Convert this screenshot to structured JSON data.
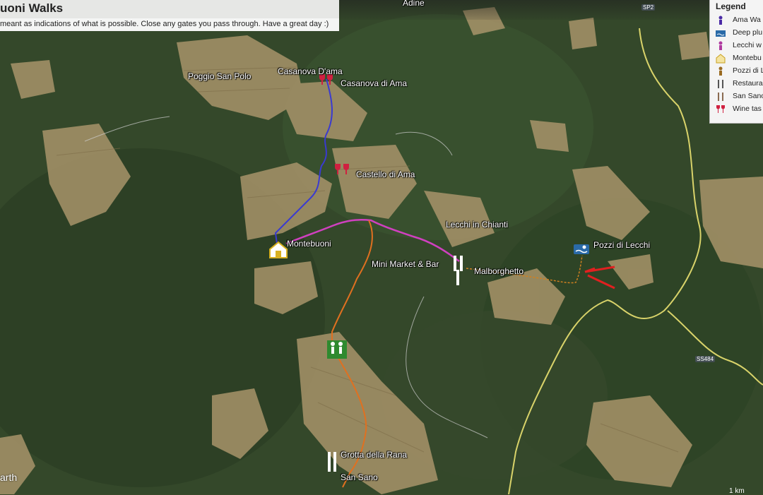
{
  "title": "uoni Walks",
  "subtitle": "meant as indications of what is possible. Close any gates you pass through. Have a great day :)",
  "top_place": "Adine",
  "legend": {
    "title": "Legend",
    "items": [
      {
        "label": "Ama Wa",
        "icon": "walker-purple-icon",
        "color": "#4a2aa6"
      },
      {
        "label": "Deep plu",
        "icon": "swimmer-icon",
        "color": "#2a6aa8"
      },
      {
        "label": "Lecchi w",
        "icon": "walker-pink-icon",
        "color": "#b03aa0"
      },
      {
        "label": "Montebu",
        "icon": "home-icon",
        "color": "#c8a020"
      },
      {
        "label": "Pozzi di L",
        "icon": "walker-brown-icon",
        "color": "#9a6a20"
      },
      {
        "label": "Restaura",
        "icon": "fork-knife-icon",
        "color": "#555555"
      },
      {
        "label": "San Sano",
        "icon": "fork-knife-icon",
        "color": "#8a6a50"
      },
      {
        "label": "Wine tas",
        "icon": "wine-glass-icon",
        "color": "#d02040"
      }
    ]
  },
  "places": [
    {
      "id": "poggio",
      "label": "Poggio San Polo"
    },
    {
      "id": "casanova-dama",
      "label": "Casanova D'ama"
    },
    {
      "id": "casanova-di-ama",
      "label": "Casanova di Ama"
    },
    {
      "id": "castello",
      "label": "Castello di Ama"
    },
    {
      "id": "montebuoni",
      "label": "Montebuoni"
    },
    {
      "id": "lecchi",
      "label": "Lecchi in Chianti"
    },
    {
      "id": "minimarket",
      "label": "Mini Market & Bar"
    },
    {
      "id": "malborghetto",
      "label": "Malborghetto"
    },
    {
      "id": "pozzi",
      "label": "Pozzi di Lecchi"
    },
    {
      "id": "grotta",
      "label": "Grotta della Rana"
    },
    {
      "id": "sansano",
      "label": "San Sano"
    }
  ],
  "roads": {
    "sp2": "SP2",
    "ss484": "SS484"
  },
  "route_colors": {
    "ama": "#3a3ad0",
    "lecchi": "#d040c0",
    "sansano": "#e07020",
    "pozzi": "#d08020",
    "arrow": "#e02020"
  },
  "earth_text": "arth",
  "scale_text": "1 km"
}
